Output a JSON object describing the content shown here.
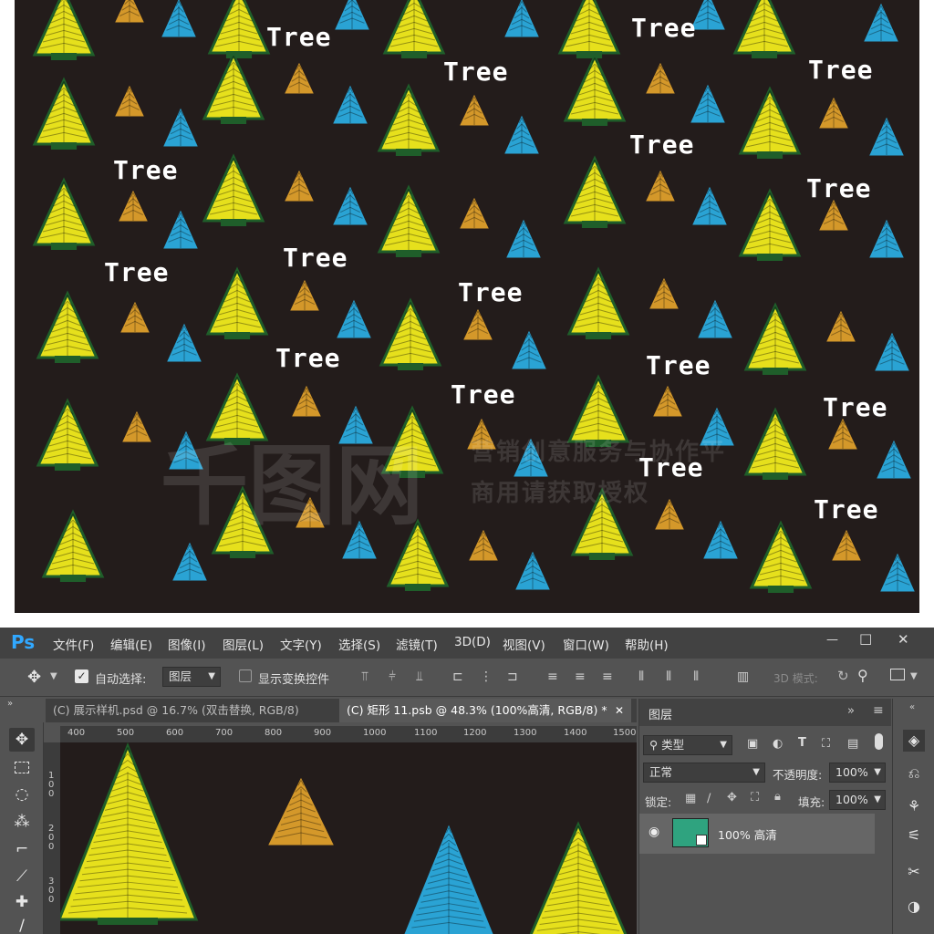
{
  "artwork": {
    "word": "Tree",
    "watermark_logo": "千图网",
    "watermark_line1": "营销创意服务与协作平",
    "watermark_line2": "商用请获取授权",
    "colors": {
      "background": "#231c1b",
      "yellow": "#e6e01c",
      "green": "#1f5e2a",
      "orange": "#d4982a",
      "blue": "#2aa3d4",
      "text": "#ffffff"
    }
  },
  "app": {
    "logo": "Ps",
    "menus": [
      "文件(F)",
      "编辑(E)",
      "图像(I)",
      "图层(L)",
      "文字(Y)",
      "选择(S)",
      "滤镜(T)",
      "3D(D)",
      "视图(V)",
      "窗口(W)",
      "帮助(H)"
    ],
    "window_controls": {
      "minimize": "—",
      "maximize": "□",
      "close": "✕"
    }
  },
  "options_bar": {
    "auto_select_label": "自动选择:",
    "auto_select_checked": true,
    "auto_select_target": "图层",
    "show_transform_label": "显示变换控件",
    "show_transform_checked": false,
    "mode_3d_label": "3D 模式:"
  },
  "tabs": [
    {
      "label": "(C) 展示样机.psd @ 16.7% (双击替换, RGB/8)",
      "active": false
    },
    {
      "label": "(C) 矩形 11.psb @ 48.3% (100%高清, RGB/8) *",
      "active": true
    }
  ],
  "ruler": {
    "h_ticks": [
      "400",
      "500",
      "600",
      "700",
      "800",
      "900",
      "1000",
      "1100",
      "1200",
      "1300",
      "1400",
      "1500"
    ],
    "v_ticks": [
      "100",
      "200",
      "300"
    ]
  },
  "layers_panel": {
    "title": "图层",
    "filter_type": "类型",
    "blend_mode": "正常",
    "opacity_label": "不透明度:",
    "opacity_value": "100%",
    "lock_label": "锁定:",
    "fill_label": "填充:",
    "fill_value": "100%",
    "layers": [
      {
        "name": "100% 高清",
        "visible": true,
        "thumb_color": "#2fa37f"
      }
    ]
  }
}
